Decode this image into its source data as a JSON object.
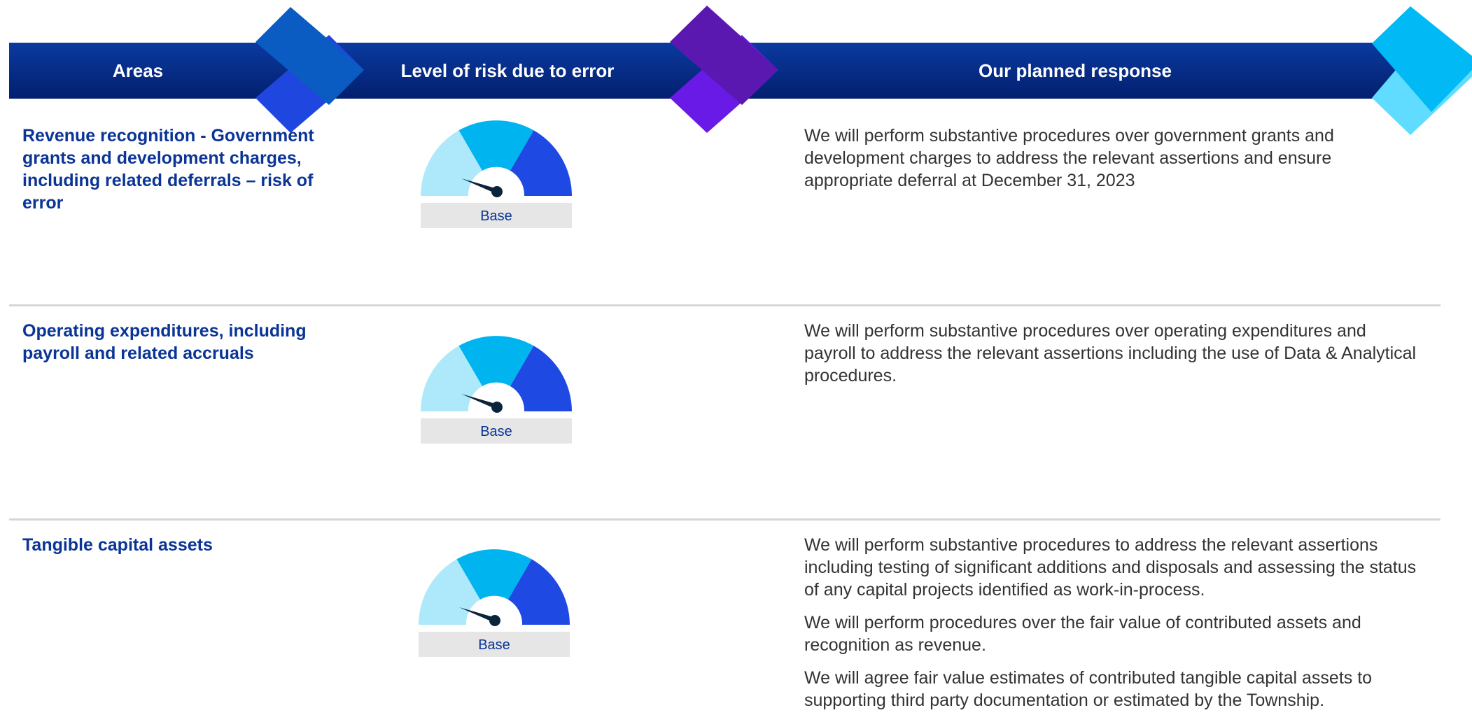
{
  "header": {
    "col_areas": "Areas",
    "col_risk": "Level of risk due to error",
    "col_response": "Our planned response"
  },
  "colors": {
    "header_band": "#031f6e",
    "title_text": "#0a3496",
    "body_text": "#333333",
    "gauge_low": "#ade9fb",
    "gauge_mid": "#00b4f0",
    "gauge_high": "#1e49e2",
    "gauge_needle": "#0c233c",
    "divider": "#d6d6d6"
  },
  "rows": [
    {
      "area": "Revenue recognition - Government grants and development charges, including related deferrals – risk of error",
      "risk_level": "Base",
      "response": [
        "We will perform substantive procedures over government grants and development charges to address the relevant assertions and ensure appropriate deferral at December 31, 2023"
      ]
    },
    {
      "area": "Operating expenditures, including payroll and related accruals",
      "risk_level": "Base",
      "response": [
        "We will perform substantive procedures over operating expenditures and payroll to address the relevant assertions including the use of Data & Analytical procedures."
      ]
    },
    {
      "area": "Tangible capital assets",
      "risk_level": "Base",
      "response": [
        "We will perform substantive procedures to address the relevant assertions including testing of significant additions and disposals and assessing the status of any capital projects identified as work-in-process.",
        "We will perform procedures over the fair value of contributed assets and recognition as revenue.",
        "We will agree fair value estimates of contributed tangible capital assets to supporting third party documentation or estimated by the Township."
      ]
    }
  ]
}
